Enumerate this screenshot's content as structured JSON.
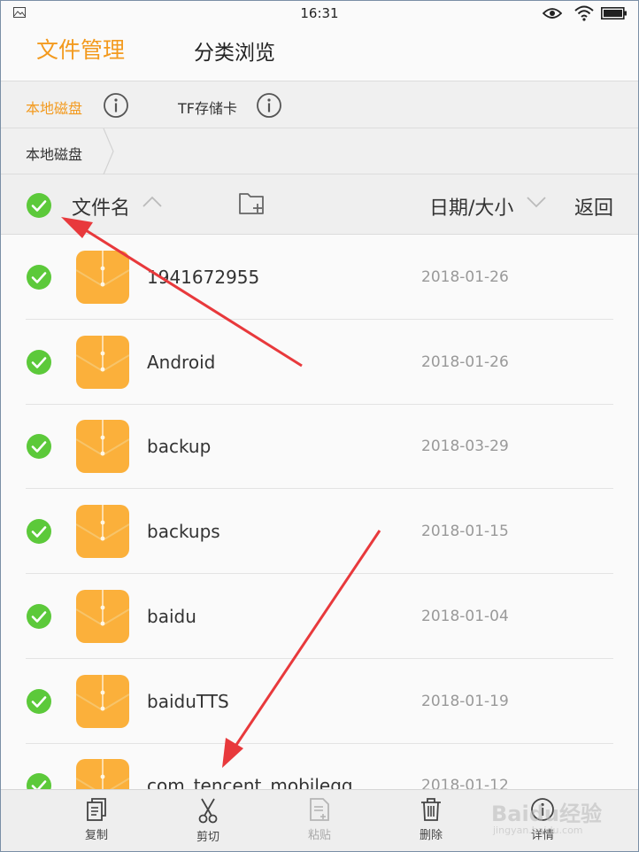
{
  "status_bar": {
    "time": "16:31"
  },
  "top_tabs": [
    {
      "label": "文件管理",
      "active": true
    },
    {
      "label": "分类浏览",
      "active": false
    }
  ],
  "storage_tabs": [
    {
      "label": "本地磁盘",
      "active": true
    },
    {
      "label": "TF存储卡",
      "active": false
    }
  ],
  "breadcrumb": {
    "current": "本地磁盘"
  },
  "list_header": {
    "name_label": "文件名",
    "date_label": "日期/大小",
    "back_label": "返回"
  },
  "files": [
    {
      "name": "1941672955",
      "date": "2018-01-26",
      "checked": true
    },
    {
      "name": "Android",
      "date": "2018-01-26",
      "checked": true
    },
    {
      "name": "backup",
      "date": "2018-03-29",
      "checked": true
    },
    {
      "name": "backups",
      "date": "2018-01-15",
      "checked": true
    },
    {
      "name": "baidu",
      "date": "2018-01-04",
      "checked": true
    },
    {
      "name": "baiduTTS",
      "date": "2018-01-19",
      "checked": true
    },
    {
      "name": "com_tencent_mobileqq",
      "date": "2018-01-12",
      "checked": true
    }
  ],
  "toolbar": {
    "copy_label": "复制",
    "cut_label": "剪切",
    "paste_label": "粘贴",
    "delete_label": "删除",
    "details_label": "详情"
  },
  "watermark": {
    "brand": "Baidu经验",
    "sub": "jingyan.baidu.com"
  },
  "colors": {
    "accent": "#f39a1e",
    "check_green": "#5cc93a",
    "folder_orange": "#fbb03b",
    "annotation_red": "#e8393c"
  },
  "icons": {
    "status_left": "gallery-icon",
    "status_right": [
      "eye-icon",
      "wifi-icon",
      "battery-icon"
    ],
    "info": "info-icon",
    "new_folder": "new-folder-icon",
    "sort": [
      "chevron-up-icon",
      "chevron-down-icon"
    ],
    "row_check": "check-circle-icon",
    "row_folder": "folder-icon",
    "toolbar": [
      "copy-icon",
      "scissors-icon",
      "paste-icon",
      "trash-icon",
      "details-icon"
    ]
  }
}
